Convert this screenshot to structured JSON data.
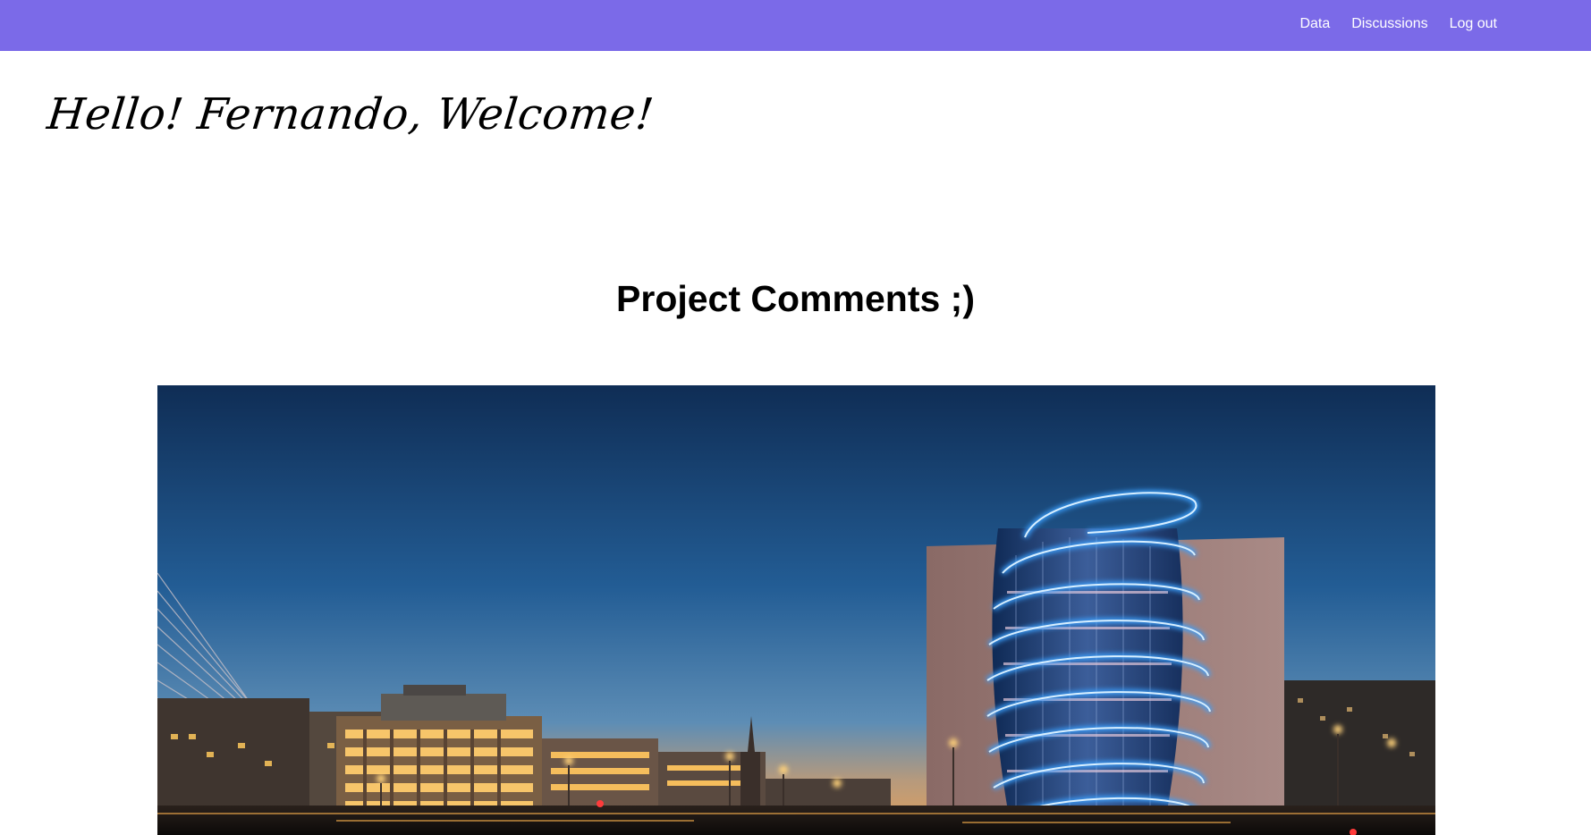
{
  "nav": {
    "links": [
      {
        "label": "Data"
      },
      {
        "label": "Discussions"
      },
      {
        "label": "Log out"
      }
    ],
    "background_color": "#7b6ae8"
  },
  "greeting": {
    "text": "Hello! Fernando, Welcome!"
  },
  "main": {
    "title": "Project Comments ;)",
    "hero_image": {
      "alt": "Night skyline with illuminated convention centre"
    }
  }
}
